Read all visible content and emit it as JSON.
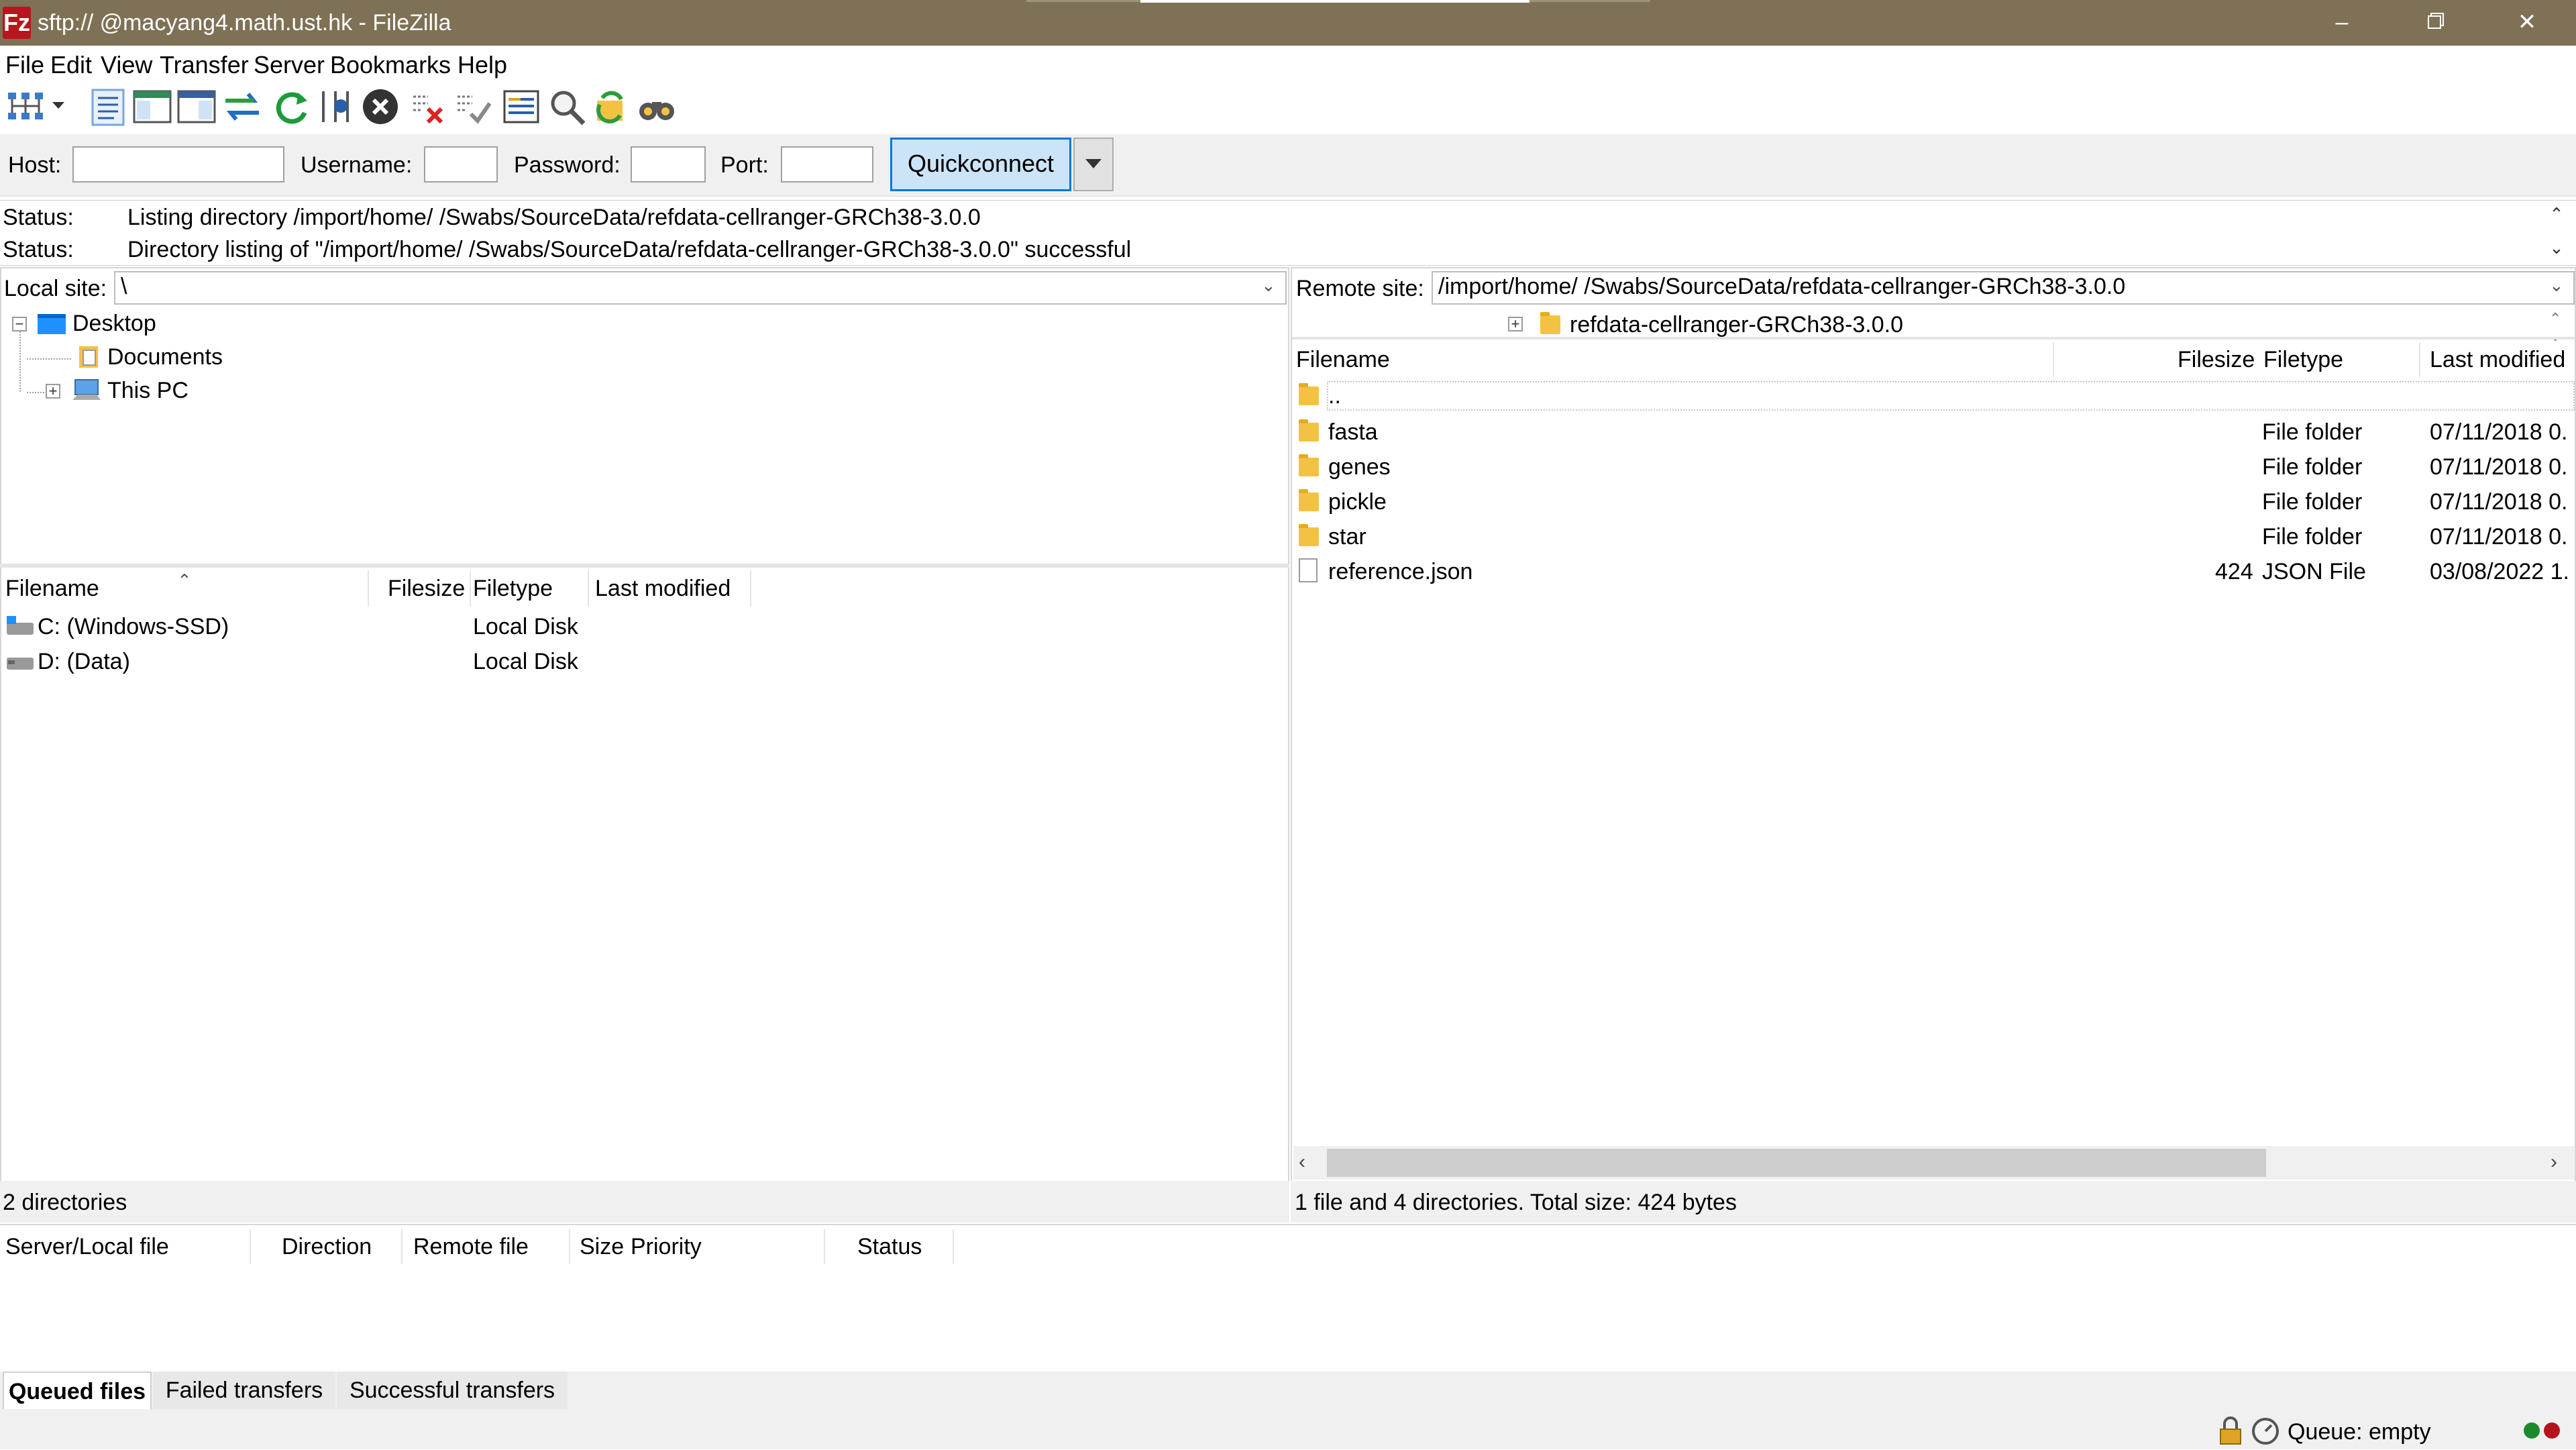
{
  "window": {
    "app_icon": "Fz",
    "title": "sftp://        @macyang4.math.ust.hk - FileZilla",
    "controls": [
      "minimize-icon",
      "restore-icon",
      "close-icon"
    ]
  },
  "menu": [
    "File",
    "Edit",
    "View",
    "Transfer",
    "Server",
    "Bookmarks",
    "Help"
  ],
  "toolbar": {
    "icons": [
      "site-manager-icon",
      "dropdown-arrow-icon",
      "toggle-message-log-icon",
      "toggle-local-tree-icon",
      "toggle-remote-tree-icon",
      "toggle-queue-icon",
      "refresh-icon",
      "process-queue-icon",
      "cancel-operation-icon",
      "disconnect-icon",
      "reconnect-icon",
      "directory-filters-icon",
      "directory-comparison-icon",
      "sync-browsing-icon",
      "search-remote-files-icon"
    ]
  },
  "quickconnect": {
    "host_label": "Host:",
    "host_value": "",
    "username_label": "Username:",
    "username_value": "",
    "password_label": "Password:",
    "password_value": "",
    "port_label": "Port:",
    "port_value": "",
    "button_label": "Quickconnect"
  },
  "message_log": [
    {
      "label": "Status:",
      "text": "Listing directory /import/home/        /Swabs/SourceData/refdata-cellranger-GRCh38-3.0.0"
    },
    {
      "label": "Status:",
      "text": "Directory listing of \"/import/home/        /Swabs/SourceData/refdata-cellranger-GRCh38-3.0.0\" successful"
    }
  ],
  "local": {
    "site_label": "Local site:",
    "path": "\\",
    "tree": [
      {
        "name": "Desktop",
        "icon": "desktop-icon",
        "expander": "−"
      },
      {
        "name": "Documents",
        "icon": "documents-folder-icon"
      },
      {
        "name": "This PC",
        "icon": "computer-icon",
        "expander": "+"
      }
    ],
    "columns": [
      "Filename",
      "Filesize",
      "Filetype",
      "Last modified"
    ],
    "rows": [
      {
        "name": "C: (Windows-SSD)",
        "size": "",
        "type": "Local Disk",
        "modified": ""
      },
      {
        "name": "D: (Data)",
        "size": "",
        "type": "Local Disk",
        "modified": ""
      }
    ],
    "status": "2 directories"
  },
  "remote": {
    "site_label": "Remote site:",
    "path": "/import/home/        /Swabs/SourceData/refdata-cellranger-GRCh38-3.0.0",
    "tree_item": "refdata-cellranger-GRCh38-3.0.0",
    "columns": [
      "Filename",
      "Filesize",
      "Filetype",
      "Last modified"
    ],
    "rows": [
      {
        "name": "..",
        "size": "",
        "type": "",
        "modified": "",
        "icon": "folder-icon"
      },
      {
        "name": "fasta",
        "size": "",
        "type": "File folder",
        "modified": "07/11/2018 0.",
        "icon": "folder-icon"
      },
      {
        "name": "genes",
        "size": "",
        "type": "File folder",
        "modified": "07/11/2018 0.",
        "icon": "folder-icon"
      },
      {
        "name": "pickle",
        "size": "",
        "type": "File folder",
        "modified": "07/11/2018 0.",
        "icon": "folder-icon"
      },
      {
        "name": "star",
        "size": "",
        "type": "File folder",
        "modified": "07/11/2018 0.",
        "icon": "folder-icon"
      },
      {
        "name": "reference.json",
        "size": "424",
        "type": "JSON File",
        "modified": "03/08/2022 1.",
        "icon": "file-icon"
      }
    ],
    "status": "1 file and 4 directories. Total size: 424 bytes"
  },
  "queue": {
    "columns": [
      "Server/Local file",
      "Direction",
      "Remote file",
      "Size",
      "Priority",
      "Status"
    ],
    "tabs": [
      "Queued files",
      "Failed transfers",
      "Successful transfers"
    ]
  },
  "statusbar": {
    "queue_text": "Queue: empty"
  }
}
